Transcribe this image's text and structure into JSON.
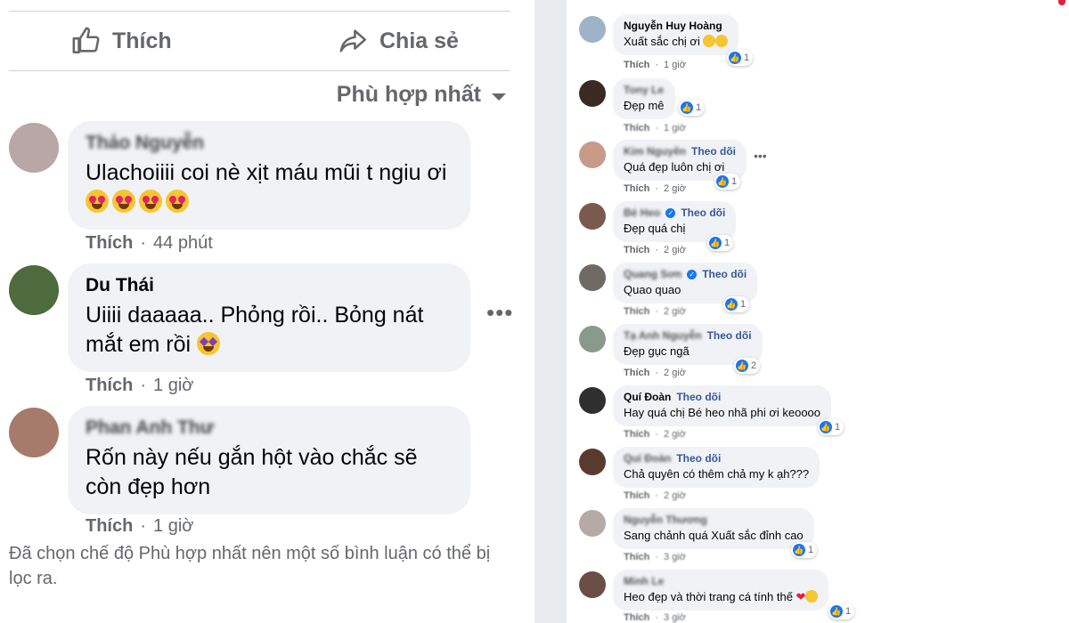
{
  "left": {
    "like_label": "Thích",
    "share_label": "Chia sẻ",
    "sort_label": "Phù hợp nhất",
    "comments": [
      {
        "name": "Thảo Nguyễn",
        "text": "Ulachoiiii coi nè xịt máu mũi t ngiu ơi",
        "like": "Thích",
        "time": "44 phút",
        "avatar_color": "#b9a6a6"
      },
      {
        "name": "Du Thái",
        "text": "Uiiii daaaaa.. Phỏng rồi.. Bỏng nát mắt em rồi",
        "like": "Thích",
        "time": "1 giờ",
        "avatar_color": "#4e6b3e"
      },
      {
        "name": "Phan Anh Thư",
        "text": "Rốn này nếu gắn hột vào chắc sẽ còn đẹp hơn",
        "like": "Thích",
        "time": "1 giờ",
        "avatar_color": "#a67b6b"
      }
    ],
    "filter_note": "Đã chọn chế độ Phù hợp nhất nên một số bình luận có thể bị lọc ra."
  },
  "right": {
    "follow_label": "Theo dõi",
    "comments": [
      {
        "name": "Nguyễn Huy Hoàng",
        "text": "Xuất sắc chị ơi",
        "like": "Thích",
        "time": "1 giờ",
        "count": "1",
        "avatar_color": "#9fb3c8"
      },
      {
        "name": "Tony Le",
        "text": "Đẹp mê",
        "like": "Thích",
        "time": "1 giờ",
        "count": "1",
        "avatar_color": "#3b2a24"
      },
      {
        "name": "Kim Nguyên",
        "text": "Quá đẹp luôn chị ơi",
        "like": "Thích",
        "time": "2 giờ",
        "count": "1",
        "avatar_color": "#c79a8a"
      },
      {
        "name": "Bé Heo",
        "text": "Đẹp quá chị",
        "like": "Thích",
        "time": "2 giờ",
        "count": "1",
        "avatar_color": "#7a5a4e"
      },
      {
        "name": "Quang Sơn",
        "text": "Quao quao",
        "like": "Thích",
        "time": "2 giờ",
        "count": "1",
        "avatar_color": "#6f6a63"
      },
      {
        "name": "Tạ Anh Nguyễn",
        "text": "Đẹp gục ngã",
        "like": "Thích",
        "time": "2 giờ",
        "count": "2",
        "avatar_color": "#8a9a8a"
      },
      {
        "name": "Quí Đoàn",
        "text": "Hay quá chị Bé heo nhã phi ơi keoooo",
        "like": "Thích",
        "time": "2 giờ",
        "count": "1",
        "avatar_color": "#2f2f2f"
      },
      {
        "name": "Quí Đoàn",
        "text": "Chả quyên có thêm chả my k ạh???",
        "like": "Thích",
        "time": "2 giờ",
        "count": "",
        "avatar_color": "#5a3a2e"
      },
      {
        "name": "Nguyễn Thương",
        "text": "Sang chảnh quá Xuất sắc đỉnh cao",
        "like": "Thích",
        "time": "3 giờ",
        "count": "1",
        "avatar_color": "#b5aaa5"
      },
      {
        "name": "Minh Le",
        "text": "Heo đẹp và thời trang cá tính thế",
        "like": "Thích",
        "time": "3 giờ",
        "count": "1",
        "avatar_color": "#6b4e46"
      }
    ]
  },
  "icons": {
    "like": "thumbs-up-icon",
    "share": "share-arrow-icon",
    "more": "more-dots-icon",
    "sort": "caret-down-icon"
  },
  "colors": {
    "bubble": "#f0f2f5",
    "meta": "#65676b",
    "follow": "#385898",
    "like_blue": "#1877f2"
  }
}
